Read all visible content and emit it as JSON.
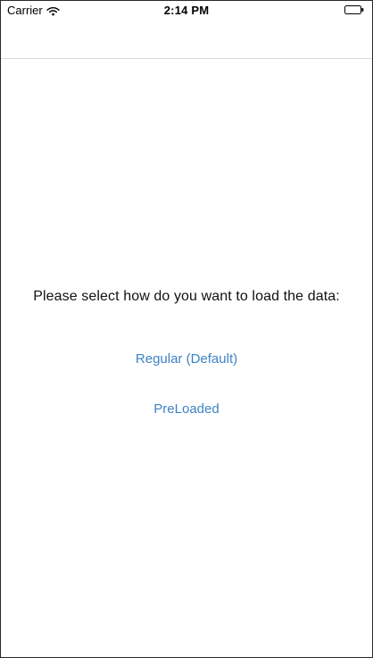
{
  "status_bar": {
    "carrier": "Carrier",
    "time": "2:14 PM",
    "wifi_icon": "wifi-icon",
    "battery_icon": "battery-icon"
  },
  "main": {
    "prompt": "Please select how do you want to load the data:",
    "options": [
      {
        "label": "Regular (Default)"
      },
      {
        "label": "PreLoaded"
      }
    ]
  },
  "colors": {
    "background": "#ffffff",
    "text": "#111111",
    "link": "#3f83c5",
    "divider": "#d9d9d9"
  }
}
